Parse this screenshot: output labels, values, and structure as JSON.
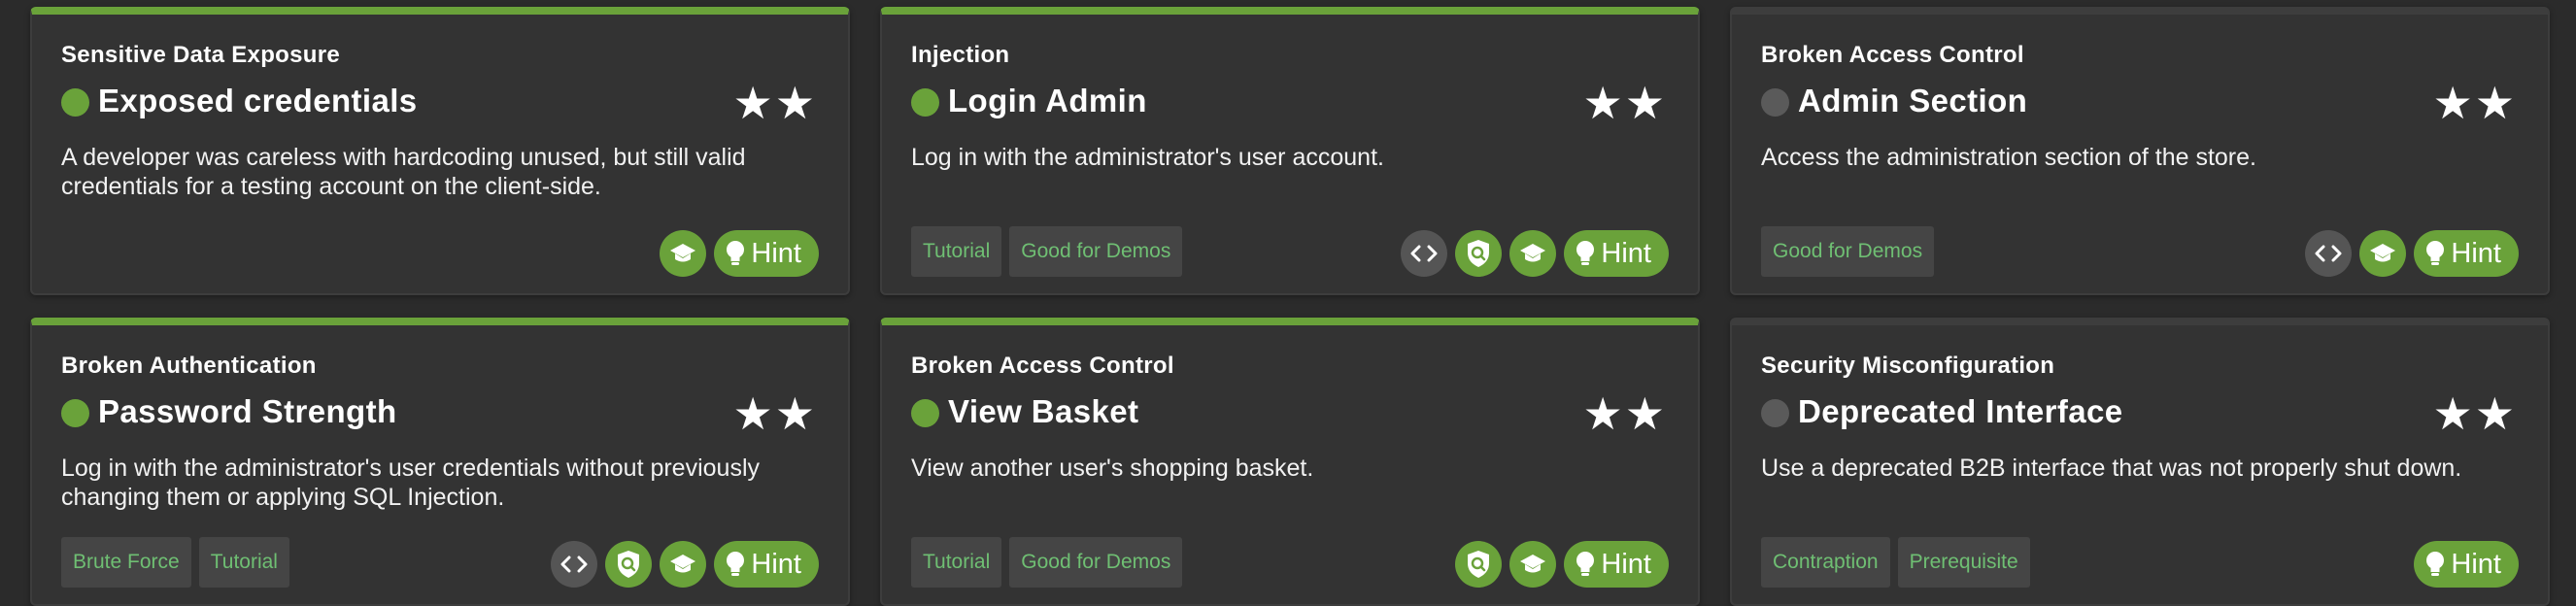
{
  "colors": {
    "background": "#2b2b2b",
    "card": "#333333",
    "accent": "#6aa23a",
    "unsolved": "#5a5a5a",
    "tag_text": "#6fbf73",
    "tag_bg": "#454545",
    "code_button": "#555555"
  },
  "hint_label": "Hint",
  "stars_glyph": "★★",
  "cards": [
    {
      "category": "Sensitive Data Exposure",
      "title": "Exposed credentials",
      "solved": true,
      "difficulty_stars": 2,
      "description": "A developer was careless with hardcoding unused, but still valid credentials for a testing account on the client-side.",
      "tags": [],
      "icons": [
        "graduation-cap-icon"
      ]
    },
    {
      "category": "Injection",
      "title": "Login Admin",
      "solved": true,
      "difficulty_stars": 2,
      "description": "Log in with the administrator's user account.",
      "tags": [
        "Tutorial",
        "Good for Demos"
      ],
      "icons": [
        "code-icon",
        "shield-search-icon",
        "graduation-cap-icon"
      ]
    },
    {
      "category": "Broken Access Control",
      "title": "Admin Section",
      "solved": false,
      "difficulty_stars": 2,
      "description": "Access the administration section of the store.",
      "tags": [
        "Good for Demos"
      ],
      "icons": [
        "code-icon",
        "graduation-cap-icon"
      ]
    },
    {
      "category": "Broken Authentication",
      "title": "Password Strength",
      "solved": true,
      "difficulty_stars": 2,
      "description": "Log in with the administrator's user credentials without previously changing them or applying SQL Injection.",
      "tags": [
        "Brute Force",
        "Tutorial"
      ],
      "icons": [
        "code-icon",
        "shield-search-icon",
        "graduation-cap-icon"
      ]
    },
    {
      "category": "Broken Access Control",
      "title": "View Basket",
      "solved": true,
      "difficulty_stars": 2,
      "description": "View another user's shopping basket.",
      "tags": [
        "Tutorial",
        "Good for Demos"
      ],
      "icons": [
        "shield-search-icon",
        "graduation-cap-icon"
      ]
    },
    {
      "category": "Security Misconfiguration",
      "title": "Deprecated Interface",
      "solved": false,
      "difficulty_stars": 2,
      "description": "Use a deprecated B2B interface that was not properly shut down.",
      "tags": [
        "Contraption",
        "Prerequisite"
      ],
      "icons": []
    }
  ]
}
